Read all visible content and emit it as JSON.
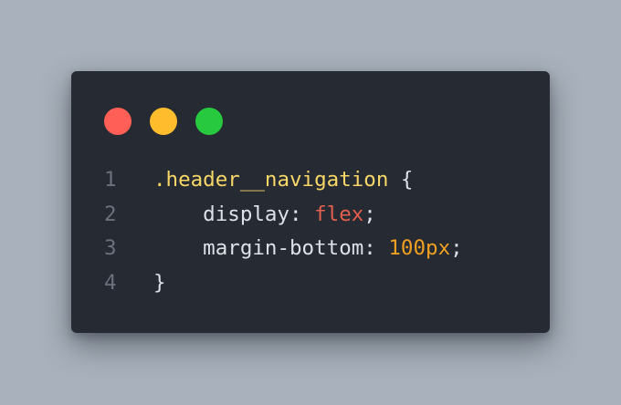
{
  "window": {
    "controls": [
      {
        "name": "close",
        "color": "#ff5f56"
      },
      {
        "name": "minimize",
        "color": "#ffbd2e"
      },
      {
        "name": "maximize",
        "color": "#27c93f"
      }
    ]
  },
  "colors": {
    "background": "#a9b2bc",
    "editor": "#262a33",
    "line_number": "#6a717d",
    "selector": "#f7d767",
    "property": "#dde1e7",
    "punct": "#dde1e7",
    "keyword_value": "#e1604d",
    "number_value": "#f0a020"
  },
  "code": {
    "lines": [
      {
        "number": "1",
        "tokens": [
          {
            "text": ".header__navigation",
            "kind": "selector"
          },
          {
            "text": " {",
            "kind": "punct"
          }
        ]
      },
      {
        "number": "2",
        "tokens": [
          {
            "text": "    display",
            "kind": "property"
          },
          {
            "text": ": ",
            "kind": "punct"
          },
          {
            "text": "flex",
            "kind": "keyword_value"
          },
          {
            "text": ";",
            "kind": "punct"
          }
        ]
      },
      {
        "number": "3",
        "tokens": [
          {
            "text": "    margin-bottom",
            "kind": "property"
          },
          {
            "text": ": ",
            "kind": "punct"
          },
          {
            "text": "100px",
            "kind": "number_value"
          },
          {
            "text": ";",
            "kind": "punct"
          }
        ]
      },
      {
        "number": "4",
        "tokens": [
          {
            "text": "}",
            "kind": "punct"
          }
        ]
      }
    ]
  }
}
